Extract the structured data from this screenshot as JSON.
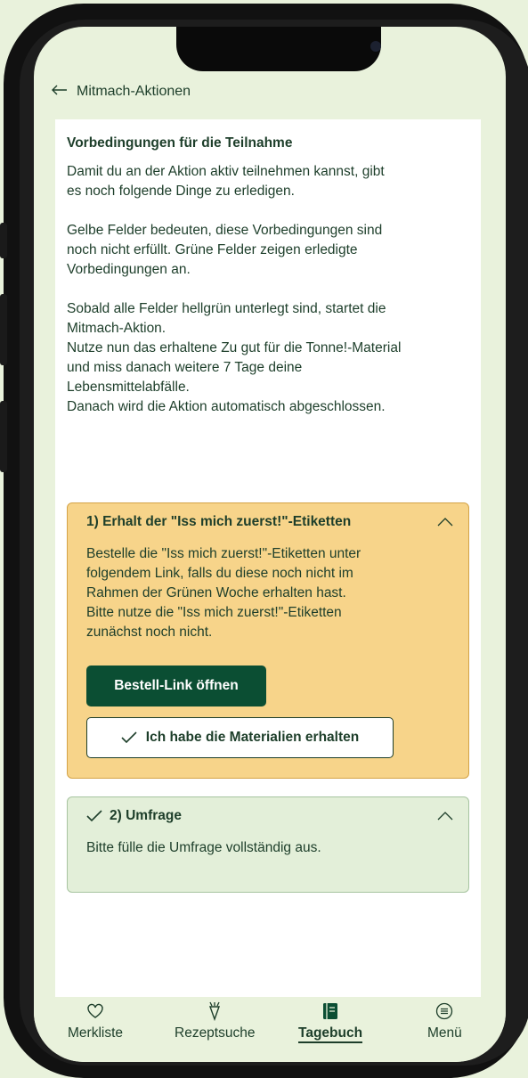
{
  "header": {
    "back_label": "Mitmach-Aktionen"
  },
  "intro": {
    "title": "Vorbedingungen für die Teilnahme",
    "p1": "Damit du an der Aktion aktiv teilnehmen kannst, gibt\nes noch folgende Dinge zu erledigen.",
    "p2": "Gelbe Felder bedeuten, diese Vorbedingungen sind\nnoch nicht erfüllt. Grüne Felder zeigen erledigte\nVorbedingungen an.",
    "p3": "Sobald alle Felder hellgrün unterlegt sind, startet die\nMitmach-Aktion.\nNutze nun das erhaltene Zu gut für die Tonne!-Material\nund miss danach weitere 7 Tage deine\nLebensmittelabfälle.\nDanach wird die Aktion automatisch abgeschlossen."
  },
  "steps": [
    {
      "title": "1) Erhalt der \"Iss mich zuerst!\"-Etiketten",
      "body": "Bestelle die \"Iss mich zuerst!\"-Etiketten unter\nfolgendem Link, falls du diese noch nicht im\nRahmen der Grünen Woche erhalten hast.\nBitte nutze die \"Iss mich zuerst!\"-Etiketten\nzunächst noch nicht.",
      "primary_button": "Bestell-Link öffnen",
      "secondary_button": "Ich habe die Materialien erhalten",
      "status_color": "#f7d48a"
    },
    {
      "title": "2) Umfrage",
      "body": "Bitte fülle die Umfrage vollständig aus.",
      "status_color": "#e3efd9"
    }
  ],
  "nav": {
    "items": [
      {
        "label": "Merkliste",
        "icon": "heart-icon"
      },
      {
        "label": "Rezeptsuche",
        "icon": "carrot-icon"
      },
      {
        "label": "Tagebuch",
        "icon": "book-icon",
        "active": true
      },
      {
        "label": "Menü",
        "icon": "menu-icon"
      }
    ]
  },
  "colors": {
    "primary": "#0b4e33",
    "text": "#1d3e2a",
    "page_bg": "#e9f2dc",
    "pending": "#f7d48a",
    "done": "#e3efd9"
  }
}
